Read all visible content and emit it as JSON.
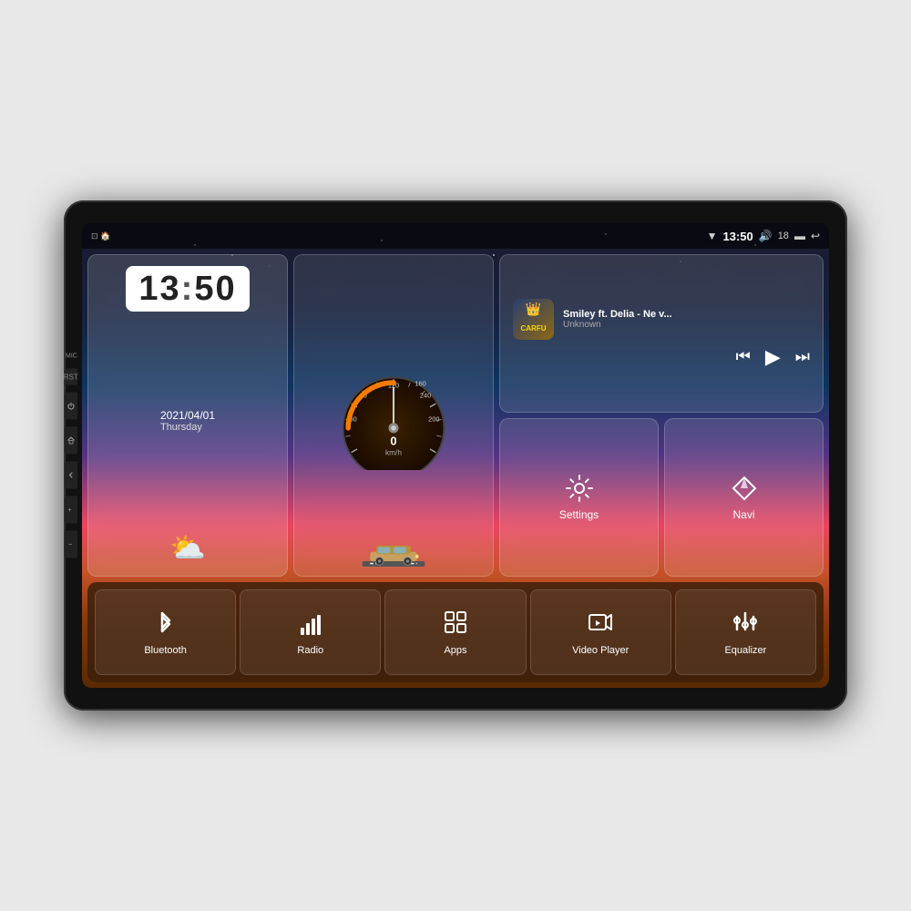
{
  "device": {
    "title": "Car Android Head Unit"
  },
  "statusBar": {
    "mic_label": "MIC",
    "time": "13:50",
    "volume": "18",
    "wifi_signal": "▼",
    "battery": "▬"
  },
  "clock": {
    "hours": "13",
    "minutes": "50",
    "date": "2021/04/01",
    "day": "Thursday"
  },
  "music": {
    "title": "Smiley ft. Delia - Ne v...",
    "artist": "Unknown",
    "logo": "CARFU"
  },
  "buttons": {
    "settings_label": "Settings",
    "navi_label": "Navi"
  },
  "bottomBar": [
    {
      "id": "bluetooth",
      "label": "Bluetooth",
      "icon": "bluetooth"
    },
    {
      "id": "radio",
      "label": "Radio",
      "icon": "radio"
    },
    {
      "id": "apps",
      "label": "Apps",
      "icon": "apps"
    },
    {
      "id": "video",
      "label": "Video Player",
      "icon": "video"
    },
    {
      "id": "equalizer",
      "label": "Equalizer",
      "icon": "equalizer"
    }
  ],
  "speedometer": {
    "value": "0",
    "unit": "km/h"
  },
  "sideButtons": [
    {
      "id": "power",
      "label": "RST"
    },
    {
      "id": "home"
    },
    {
      "id": "back"
    },
    {
      "id": "vol_up"
    },
    {
      "id": "vol_down"
    }
  ]
}
